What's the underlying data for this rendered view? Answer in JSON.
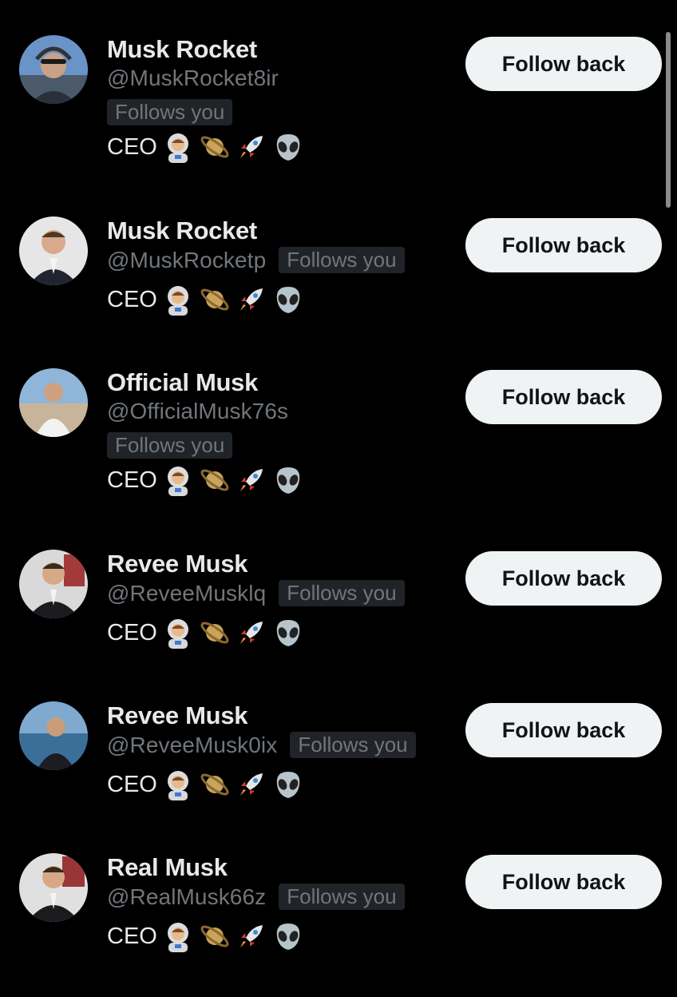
{
  "follow_button_label": "Follow back",
  "follows_you_label": "Follows you",
  "bio_text": "CEO",
  "bio_emojis": [
    "astronaut-emoji",
    "ringed-planet-emoji",
    "rocket-emoji",
    "alien-emoji"
  ],
  "colors": {
    "background": "#000000",
    "name": "#e7e9ea",
    "handle": "#71767b",
    "badge_bg": "#202327",
    "button_bg": "#eff3f4",
    "button_text": "#0f1419"
  },
  "accounts": [
    {
      "name": "Musk Rocket",
      "handle": "@MuskRocket8ir",
      "badge_layout": "below"
    },
    {
      "name": "Musk Rocket",
      "handle": "@MuskRocketp",
      "badge_layout": "inline"
    },
    {
      "name": "Official Musk",
      "handle": "@OfficialMusk76s",
      "badge_layout": "below"
    },
    {
      "name": "Revee Musk",
      "handle": "@ReveeMusklq",
      "badge_layout": "inline"
    },
    {
      "name": "Revee Musk",
      "handle": "@ReveeMusk0ix",
      "badge_layout": "inline"
    },
    {
      "name": "Real Musk",
      "handle": "@RealMusk66z",
      "badge_layout": "inline"
    }
  ]
}
